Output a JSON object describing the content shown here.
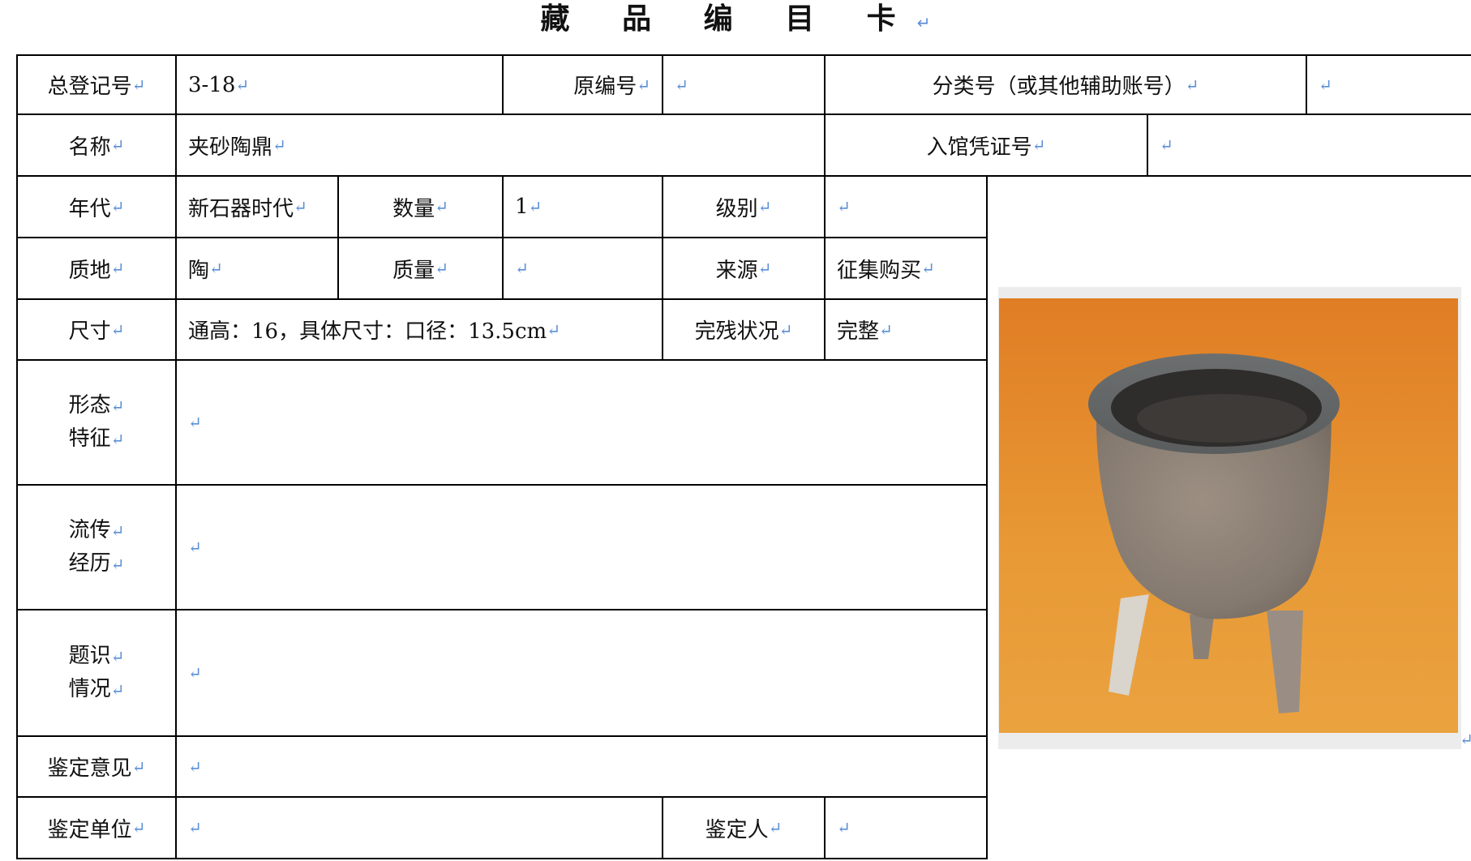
{
  "title": "藏 品 编 目 卡",
  "mark": "↵",
  "fields": {
    "reg_no_label": "总登记号",
    "reg_no_value": "3-18",
    "orig_no_label": "原编号",
    "orig_no_value": "",
    "class_no_label": "分类号（或其他辅助账号）",
    "class_no_value": "",
    "name_label": "名称",
    "name_value": "夹砂陶鼎",
    "voucher_label": "入馆凭证号",
    "voucher_value": "",
    "era_label": "年代",
    "era_value": "新石器时代",
    "qty_label": "数量",
    "qty_value": "1",
    "grade_label": "级别",
    "grade_value": "",
    "material_label": "质地",
    "material_value": "陶",
    "weight_label": "质量",
    "weight_value": "",
    "source_label": "来源",
    "source_value": "征集购买",
    "size_label": "尺寸",
    "size_value": "通高：16，具体尺寸：口径：13.5cm",
    "condition_label": "完残状况",
    "condition_value": "完整",
    "features_label_1": "形态",
    "features_label_2": "特征",
    "features_value": "",
    "history_label_1": "流传",
    "history_label_2": "经历",
    "history_value": "",
    "inscription_label_1": "题识",
    "inscription_label_2": "情况",
    "inscription_value": "",
    "opinion_label": "鉴定意见",
    "opinion_value": "",
    "unit_label": "鉴定单位",
    "unit_value": "",
    "appraiser_label": "鉴定人",
    "appraiser_value": ""
  },
  "colors": {
    "border": "#000000",
    "mark": "#5b8fd6",
    "photo_bg": "#e79a2e",
    "pot": "#8e8378"
  }
}
